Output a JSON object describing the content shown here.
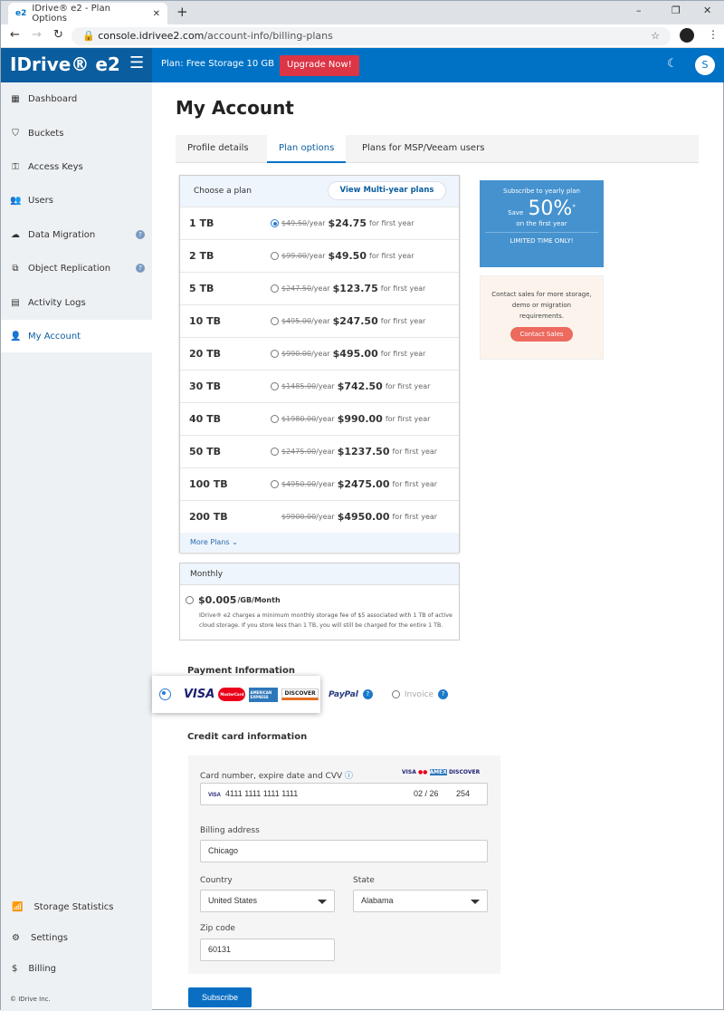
{
  "browser": {
    "tab_title": "IDrive® e2 - Plan Options",
    "url_host": "console.idrivee2.com",
    "url_path": "/account-info/billing-plans"
  },
  "header": {
    "logo": "IDrive® e2",
    "plan": "Plan: Free Storage 10 GB",
    "upgrade": "Upgrade Now!",
    "avatar": "S"
  },
  "sidebar": {
    "items": [
      "Dashboard",
      "Buckets",
      "Access Keys",
      "Users",
      "Data Migration",
      "Object Replication",
      "Activity Logs",
      "My Account"
    ],
    "bottom": [
      "Storage Statistics",
      "Settings",
      "Billing"
    ],
    "copyright": "© IDrive Inc."
  },
  "page": {
    "title": "My Account",
    "tabs": [
      "Profile details",
      "Plan options",
      "Plans for MSP/Veeam users"
    ]
  },
  "plans": {
    "header": "Choose a plan",
    "multi_year": "View Multi-year plans",
    "per_year": "/year",
    "first_year": "for first year",
    "more": "More Plans",
    "rows": [
      {
        "size": "1 TB",
        "old": "$49.50",
        "new": "$24.75",
        "selected": true
      },
      {
        "size": "2 TB",
        "old": "$99.00",
        "new": "$49.50"
      },
      {
        "size": "5 TB",
        "old": "$247.50",
        "new": "$123.75"
      },
      {
        "size": "10 TB",
        "old": "$495.00",
        "new": "$247.50"
      },
      {
        "size": "20 TB",
        "old": "$990.00",
        "new": "$495.00"
      },
      {
        "size": "30 TB",
        "old": "$1485.00",
        "new": "$742.50"
      },
      {
        "size": "40 TB",
        "old": "$1980.00",
        "new": "$990.00"
      },
      {
        "size": "50 TB",
        "old": "$2475.00",
        "new": "$1237.50"
      },
      {
        "size": "100 TB",
        "old": "$4950.00",
        "new": "$2475.00"
      },
      {
        "size": "200 TB",
        "old": "$9900.00",
        "new": "$4950.00",
        "no_radio": true
      }
    ]
  },
  "monthly": {
    "header": "Monthly",
    "price": "$0.005",
    "unit": "/GB/Month",
    "note": "IDrive® e2 charges a minimum monthly storage fee of $5 associated with 1 TB of active cloud storage. If you store less than 1 TB, you will still be charged for the entire 1 TB."
  },
  "promo": {
    "line1": "Subscribe to yearly plan",
    "save": "Save",
    "pct": "50%",
    "star": "*",
    "line3": "on the first year",
    "limited": "LIMITED TIME ONLY!"
  },
  "contact": {
    "text": "Contact sales for more storage, demo or migration requirements.",
    "button": "Contact Sales"
  },
  "payment": {
    "title": "Payment Information",
    "cards": [
      "VISA",
      "MasterCard",
      "AMERICAN EXPRESS",
      "DISCOVER"
    ],
    "paypal": "PayPal",
    "invoice": "Invoice"
  },
  "cc": {
    "title": "Credit card information",
    "card_label": "Card number, expire date and CVV",
    "card_brand": "VISA",
    "card_number": "4111 1111 1111 1111",
    "expiry": "02 / 26",
    "cvv": "254",
    "billing_label": "Billing address",
    "billing": "Chicago",
    "country_label": "Country",
    "country": "United States",
    "state_label": "State",
    "state": "Alabama",
    "zip_label": "Zip code",
    "zip": "60131",
    "subscribe": "Subscribe"
  },
  "colors": {
    "brand": "#0072c6",
    "danger": "#dc3545",
    "promo": "#4592cf",
    "contact_btn": "#ec6a5e"
  }
}
